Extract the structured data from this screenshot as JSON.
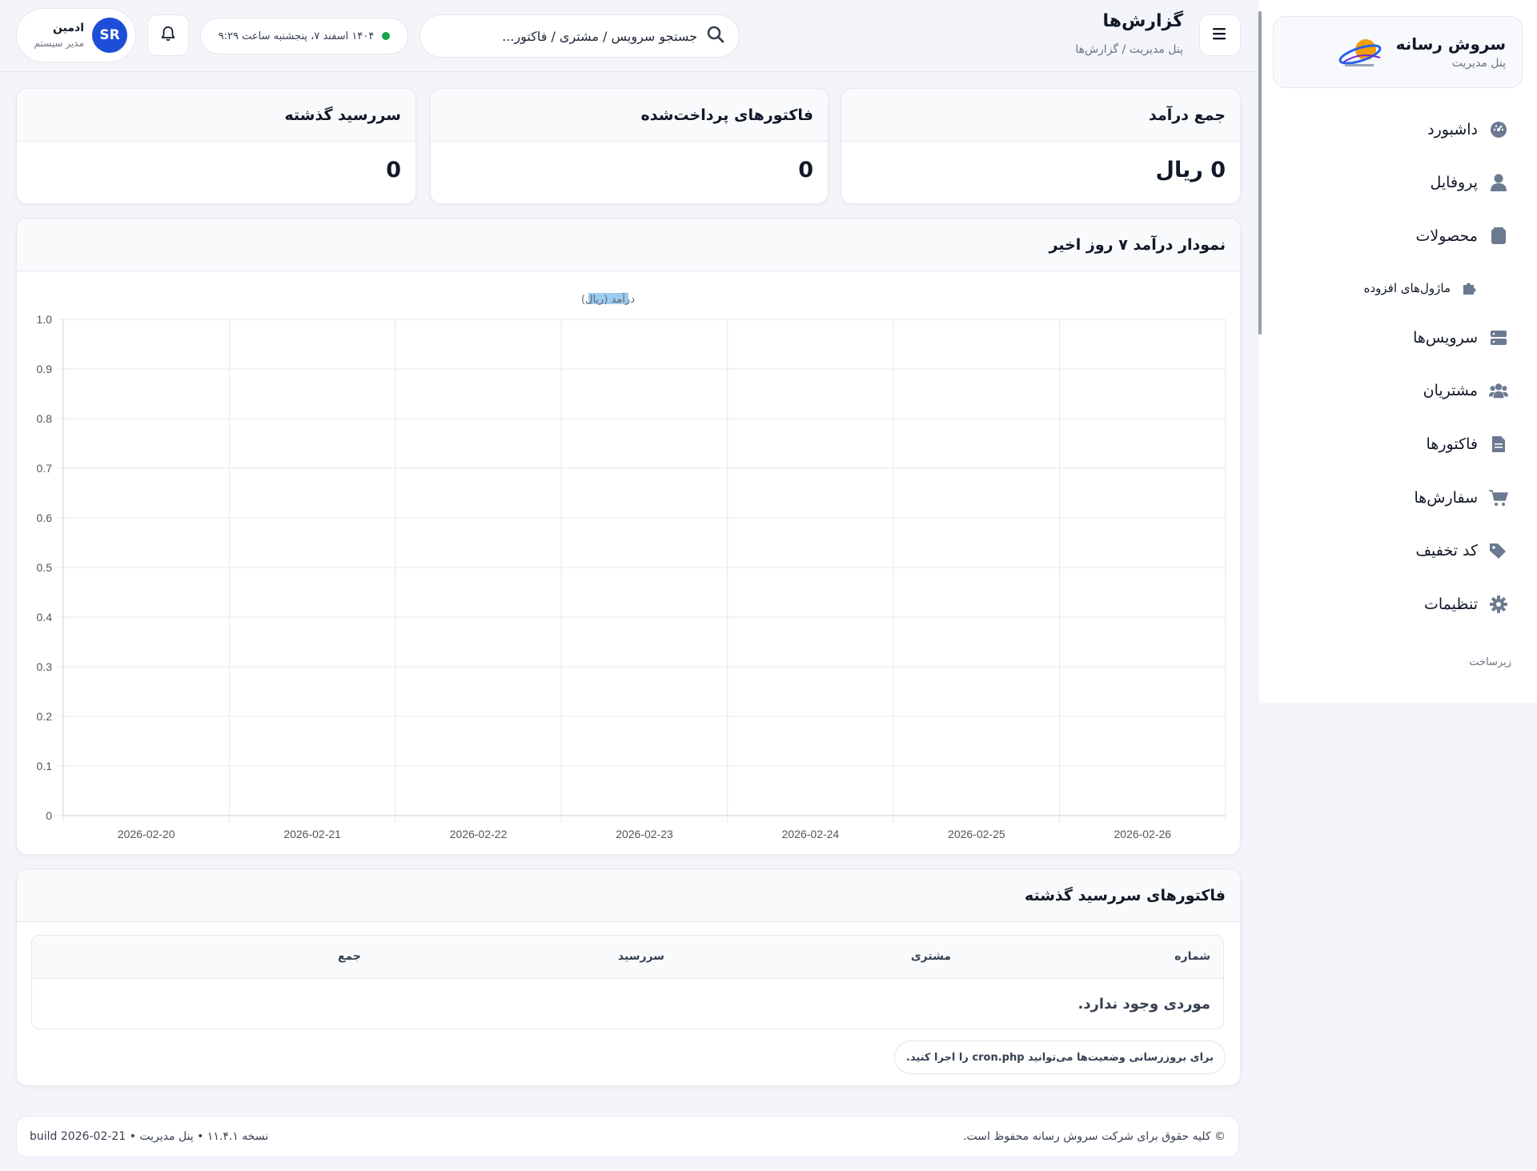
{
  "sidebar": {
    "brand_name": "سروش رسانه",
    "brand_sub": "پنل مدیریت",
    "items": [
      {
        "label": "داشبورد",
        "icon": "dashboard-icon"
      },
      {
        "label": "پروفایل",
        "icon": "user-icon"
      },
      {
        "label": "محصولات",
        "icon": "box-icon"
      },
      {
        "label": "ماژول‌های افزوده",
        "icon": "puzzle-icon"
      },
      {
        "label": "سرویس‌ها",
        "icon": "server-icon"
      },
      {
        "label": "مشتریان",
        "icon": "users-icon"
      },
      {
        "label": "فاکتورها",
        "icon": "invoice-icon"
      },
      {
        "label": "سفارش‌ها",
        "icon": "cart-icon"
      },
      {
        "label": "کد تخفیف",
        "icon": "tags-icon"
      },
      {
        "label": "تنظیمات",
        "icon": "gear-icon"
      }
    ],
    "section_label": "زیرساخت"
  },
  "header": {
    "title": "گزارش‌ها",
    "breadcrumb": "پنل مدیریت / گزارش‌ها",
    "search_placeholder": "جستجو سرویس / مشتری / فاکتور...",
    "clock_text": "۱۴۰۴ اسفند ۷، پنجشنبه ساعت ۹:۲۹",
    "user_initials": "SR",
    "user_name": "ادمین",
    "user_role": "مدیر سیستم"
  },
  "stats": [
    {
      "title": "جمع درآمد",
      "value": "0 ریال"
    },
    {
      "title": "فاکتورهای پرداخت‌شده",
      "value": "0"
    },
    {
      "title": "سررسید گذشته",
      "value": "0"
    }
  ],
  "chart_card": {
    "title": "نمودار درآمد ۷ روز اخیر"
  },
  "chart_data": {
    "type": "bar",
    "categories": [
      "2026-02-20",
      "2026-02-21",
      "2026-02-22",
      "2026-02-23",
      "2026-02-24",
      "2026-02-25",
      "2026-02-26"
    ],
    "series": [
      {
        "name": "درآمد (ریال)",
        "values": [
          0,
          0,
          0,
          0,
          0,
          0,
          0
        ],
        "color": "#9ccbf0"
      }
    ],
    "ylim": [
      0,
      1.0
    ],
    "yticks": [
      "0",
      "0.1",
      "0.2",
      "0.3",
      "0.4",
      "0.5",
      "0.6",
      "0.7",
      "0.8",
      "0.9",
      "1.0"
    ],
    "grid": true,
    "legend": "top-center"
  },
  "overdue": {
    "title": "فاکتورهای سررسید گذشته",
    "columns": [
      "شماره",
      "مشتری",
      "سررسید",
      "جمع"
    ],
    "empty_text": "موردی وجود ندارد.",
    "note": "برای بروزرسانی وضعیت‌ها می‌توانید cron.php را اجرا کنید."
  },
  "footer": {
    "copyright": "© کلیه حقوق برای شرکت سروش رسانه محفوظ است.",
    "version": "نسخه ۱۱.۴.۱ • پنل مدیریت • build 2026-02-21"
  },
  "colors": {
    "accent": "#1d4ed8",
    "status_online": "#16a34a",
    "nav_icon": "#6b7a90"
  }
}
